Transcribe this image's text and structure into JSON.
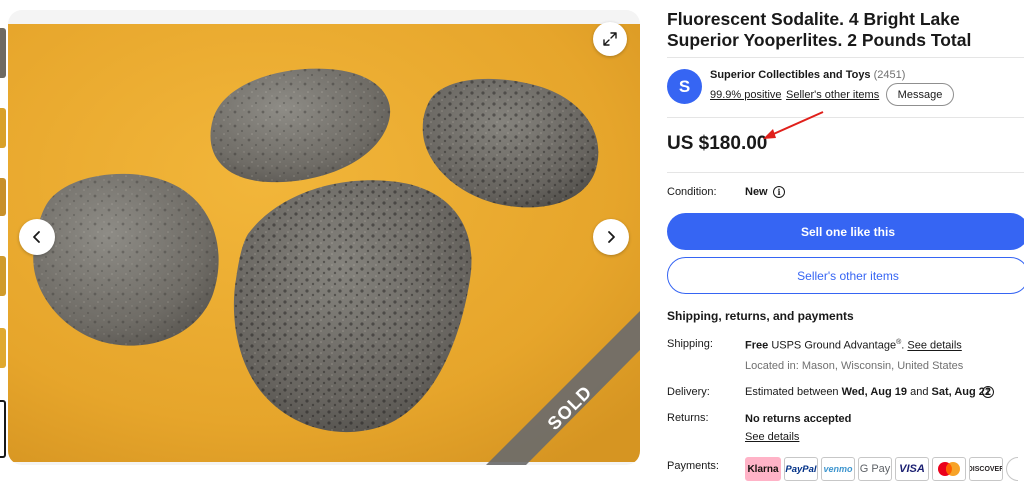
{
  "listing": {
    "title": "Fluorescent Sodalite. 4 Bright Lake Superior Yooperlites. 2 Pounds Total",
    "sold_badge": "SOLD",
    "price": "US $180.00"
  },
  "seller": {
    "avatar_letter": "S",
    "name": "Superior Collectibles and Toys",
    "feedback_count": "(2451)",
    "positive": "99.9% positive",
    "other_items_link": "Seller's other items",
    "message_button": "Message"
  },
  "condition": {
    "label": "Condition:",
    "value": "New"
  },
  "actions": {
    "primary": "Sell one like this",
    "secondary": "Seller's other items"
  },
  "shipping_section": {
    "heading": "Shipping, returns, and payments",
    "shipping_label": "Shipping:",
    "shipping_free": "Free",
    "shipping_method": "USPS Ground Advantage",
    "shipping_sup": "®",
    "shipping_details": "See details",
    "location": "Located in: Mason, Wisconsin, United States",
    "delivery_label": "Delivery:",
    "delivery_prefix": "Estimated between",
    "delivery_start": "Wed, Aug 19",
    "delivery_and": "and",
    "delivery_end": "Sat, Aug 22",
    "returns_label": "Returns:",
    "returns_value": "No returns accepted",
    "returns_details": "See details",
    "payments_label": "Payments:"
  },
  "payments": {
    "klarna": "Klarna",
    "paypal": "PayPal",
    "venmo": "venmo",
    "gpay": "G Pay",
    "visa": "VISA",
    "discover": "DISCOVER"
  },
  "icons": {
    "prev": "chevron-left-icon",
    "next": "chevron-right-icon",
    "expand": "expand-icon",
    "info": "info-icon"
  },
  "colors": {
    "brand_blue": "#3665f3",
    "annotation_red": "#e0201b",
    "background_yellow": "#e9a92c"
  }
}
